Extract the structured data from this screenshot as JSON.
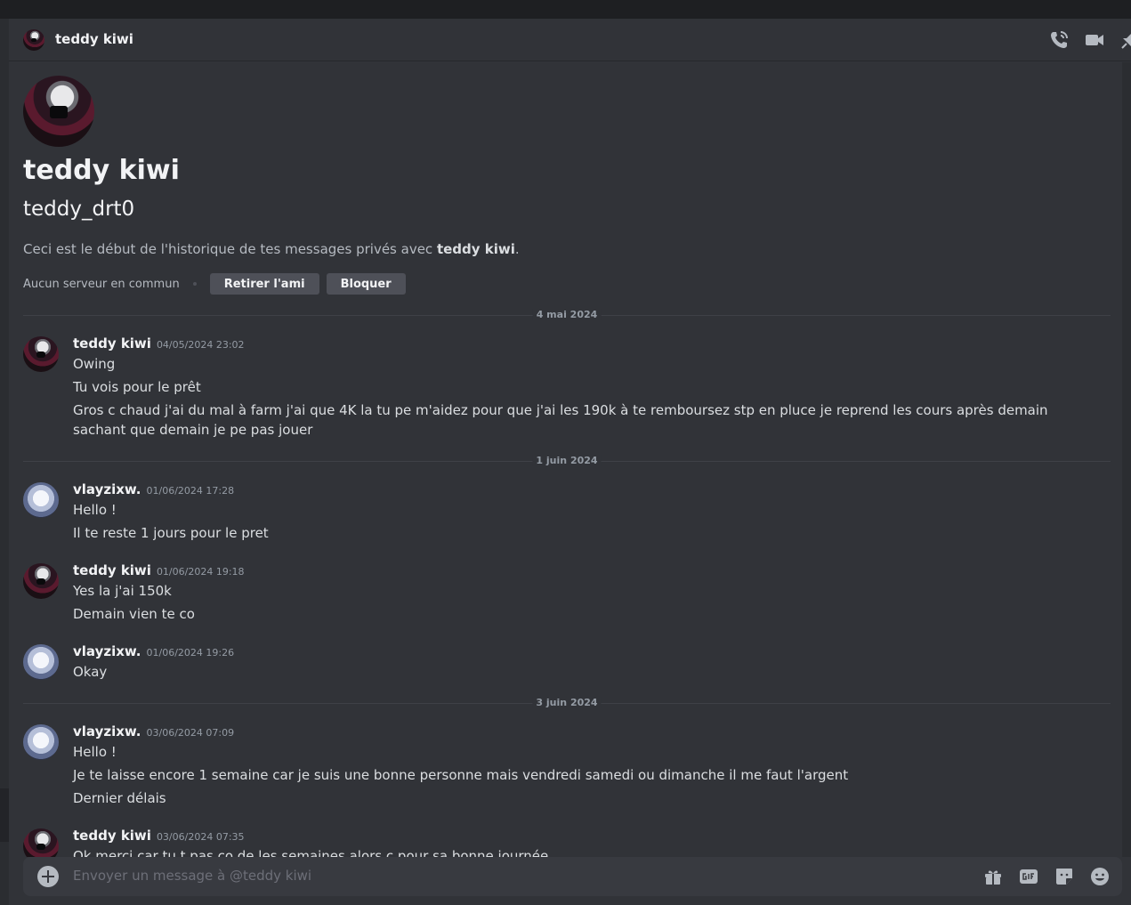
{
  "header": {
    "name": "teddy kiwi"
  },
  "profile": {
    "display_name": "teddy kiwi",
    "username": "teddy_drt0",
    "intro_prefix": "Ceci est le début de l'historique de tes messages privés avec ",
    "intro_name": "teddy kiwi",
    "intro_suffix": ".",
    "no_common_servers": "Aucun serveur en commun",
    "remove_friend_label": "Retirer l'ami",
    "block_label": "Bloquer"
  },
  "dividers": [
    "4 mai 2024",
    "1 juin 2024",
    "3 juin 2024"
  ],
  "messages": [
    {
      "author": "teddy kiwi",
      "time": "04/05/2024 23:02",
      "lines": [
        "Owing",
        "Tu vois pour le prêt",
        "Gros c chaud j'ai du mal à farm j'ai que 4K la tu pe m'aidez pour que j'ai les 190k à te remboursez stp en pluce je reprend les cours après demain sachant que demain je pe pas jouer"
      ]
    },
    {
      "author": "vlayzixw.",
      "time": "01/06/2024 17:28",
      "lines": [
        "Hello !",
        "Il te reste 1 jours pour le pret"
      ]
    },
    {
      "author": "teddy kiwi",
      "time": "01/06/2024 19:18",
      "lines": [
        "Yes la j'ai 150k",
        "Demain vien te co"
      ]
    },
    {
      "author": "vlayzixw.",
      "time": "01/06/2024 19:26",
      "lines": [
        "Okay"
      ]
    },
    {
      "author": "vlayzixw.",
      "time": "03/06/2024 07:09",
      "lines": [
        "Hello !",
        "Je te laisse encore 1 semaine car je suis une bonne personne mais vendredi samedi ou dimanche il me faut l'argent",
        "Dernier délais"
      ]
    },
    {
      "author": "teddy kiwi",
      "time": "03/06/2024 07:35",
      "lines": [
        "Ok merci car tu t pas co de les semaines alors c pour sa bonne journée"
      ]
    }
  ],
  "composer": {
    "placeholder": "Envoyer un message à @teddy kiwi"
  },
  "colors": {
    "background": "#313338",
    "composer": "#383a40",
    "text": "#dbdee1",
    "muted": "#949ba4"
  }
}
